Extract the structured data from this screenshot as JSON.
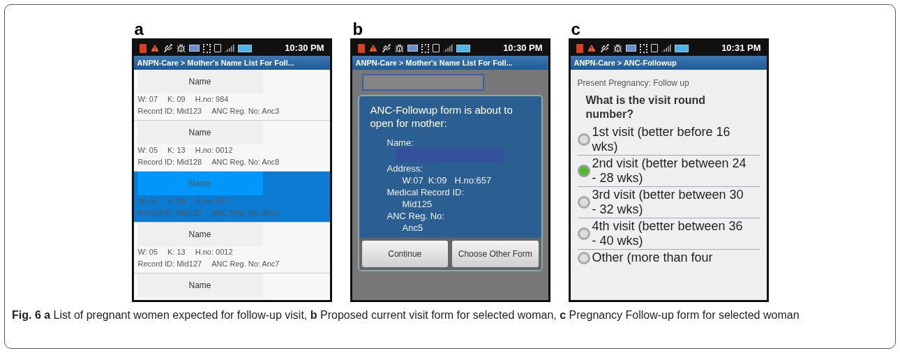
{
  "panels": [
    {
      "kind": "list",
      "letter": "a",
      "status_time": "10:30 PM",
      "title": "ANPN-Care > Mother's Name List For Foll...",
      "rows": [
        {
          "name": "Name",
          "address": [
            "W: 07",
            "K: 09",
            "H.no: 984"
          ],
          "ids": [
            "Record ID: Mid123",
            "ANC Reg. No: Anc3"
          ],
          "selected": false
        },
        {
          "name": "Name",
          "address": [
            "W: 05",
            "K: 13",
            "H.no: 0012"
          ],
          "ids": [
            "Record ID: Mid128",
            "ANC Reg. No: Anc8"
          ],
          "selected": false
        },
        {
          "name": "Name",
          "address": [
            "W: 07",
            "K: 09",
            "H.no: 657"
          ],
          "ids": [
            "Record ID: Mid125",
            "ANC Reg. No: Anc5"
          ],
          "selected": true
        },
        {
          "name": "Name",
          "address": [
            "W: 05",
            "K: 13",
            "H.no: 0012"
          ],
          "ids": [
            "Record ID: Mid127",
            "ANC Reg. No: Anc7"
          ],
          "selected": false
        },
        {
          "name": "Name",
          "address": [],
          "ids": [],
          "selected": false
        }
      ]
    },
    {
      "kind": "dialog",
      "letter": "b",
      "status_time": "10:30 PM",
      "title": "ANPN-Care > Mother's Name List For Foll...",
      "dialog": {
        "heading": "ANC-Followup form is about to open for mother:",
        "fields": [
          {
            "label": "Name:",
            "redacted": true
          },
          {
            "label": "Address:",
            "value": "W:07  K:09   H.no:657"
          },
          {
            "label": "Medical Record ID:",
            "value": "Mid125"
          },
          {
            "label": "ANC Reg. No:",
            "value": "Anc5"
          }
        ],
        "buttons": [
          "Continue",
          "Choose Other Form"
        ]
      }
    },
    {
      "kind": "form",
      "letter": "c",
      "status_time": "10:31 PM",
      "title": "ANPN-Care > ANC-Followup",
      "section": "Present Pregnancy: Follow up",
      "question": "What is the visit round number?",
      "options": [
        {
          "label": "1st visit (better before 16 wks)",
          "selected": false
        },
        {
          "label": "2nd visit (better between 24 - 28 wks)",
          "selected": true
        },
        {
          "label": "3rd visit (better between 30 - 32 wks)",
          "selected": false
        },
        {
          "label": "4th visit (better between 36 - 40 wks)",
          "selected": false
        },
        {
          "label": "Other (more than four",
          "selected": false
        }
      ]
    }
  ],
  "caption": "**Fig. 6 a** List of pregnant women expected for follow-up visit, **b** Proposed current visit form for selected woman, **c** Pregnancy Follow-up form for selected woman"
}
